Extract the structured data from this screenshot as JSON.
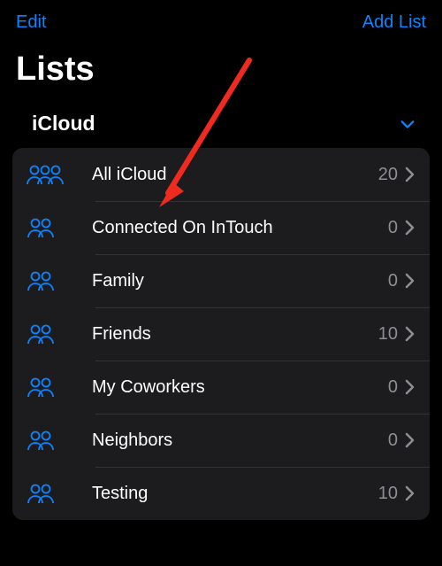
{
  "topbar": {
    "edit_label": "Edit",
    "add_list_label": "Add List"
  },
  "page_title": "Lists",
  "section": {
    "title": "iCloud",
    "expanded": true
  },
  "colors": {
    "accent": "#0a84ff",
    "secondary": "#8e8e93",
    "card_bg": "#1c1c1e"
  },
  "lists": [
    {
      "label": "All iCloud",
      "count": 20,
      "icon": "people-three"
    },
    {
      "label": "Connected On InTouch",
      "count": 0,
      "icon": "people-two"
    },
    {
      "label": "Family",
      "count": 0,
      "icon": "people-two"
    },
    {
      "label": "Friends",
      "count": 10,
      "icon": "people-two"
    },
    {
      "label": "My Coworkers",
      "count": 0,
      "icon": "people-two"
    },
    {
      "label": "Neighbors",
      "count": 0,
      "icon": "people-two"
    },
    {
      "label": "Testing",
      "count": 10,
      "icon": "people-two"
    }
  ]
}
